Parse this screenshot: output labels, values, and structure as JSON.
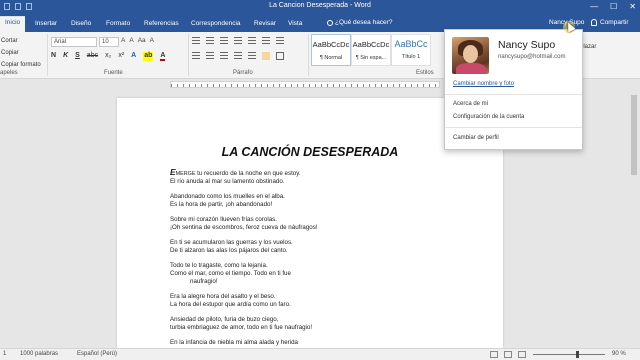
{
  "window": {
    "title": "La Cancion Desesperada - Word",
    "controls": [
      "—",
      "☐",
      "✕"
    ]
  },
  "tabs": [
    "Inicio",
    "Insertar",
    "Diseño",
    "Formato",
    "Referencias",
    "Correspondencia",
    "Revisar",
    "Vista"
  ],
  "tell_me": "¿Qué desea hacer?",
  "account": {
    "name_short": "Nancy Supo",
    "share_label": "Compartir"
  },
  "clipboard": {
    "items": [
      "Cortar",
      "Copiar",
      "Copiar formato"
    ],
    "group": "apeles"
  },
  "font": {
    "family": "Arial",
    "size": "10",
    "group": "Fuente",
    "size_buttons": [
      "A",
      "A",
      "Aa",
      "A"
    ]
  },
  "paragraph": {
    "group": "Párrafo"
  },
  "styles": {
    "group": "Estilos",
    "items": [
      {
        "preview": "AaBbCcDc",
        "name": "¶ Normal"
      },
      {
        "preview": "AaBbCcDc",
        "name": "¶ Sin espa..."
      },
      {
        "preview": "AaBbCc",
        "name": "Título 1"
      }
    ]
  },
  "ribbon_right": "plazar",
  "popup": {
    "name": "Nancy Supo",
    "email": "nancysupo@hotmail.com",
    "change_photo": "Cambiar nombre y foto",
    "about": "Acerca de mí",
    "settings": "Configuración de la cuenta",
    "switch_profile": "Cambiar de perfil"
  },
  "document": {
    "title": "LA CANCIÓN DESESPERADA",
    "drop_cap": "E",
    "first_word_rest": "MERGE",
    "first_line_rest": " tu recuerdo de la noche en que estoy.",
    "stanzas": [
      [
        "El río anuda al mar su lamento obstinado."
      ],
      [
        "Abandonado como los muelles en el alba.",
        "Es la hora de partir, ¡oh abandonado!"
      ],
      [
        "Sobre mi corazón llueven frías corolas.",
        "¡Oh sentina de escombros, feroz cueva de náufragos!"
      ],
      [
        "En ti se acumularon las guerras y los vuelos.",
        "De ti alzaron las alas los pájaros del canto."
      ],
      [
        "Todo te lo tragaste, como la lejanía.",
        "Como el mar, como el tiempo. Todo en ti fue",
        "naufragio!"
      ],
      [
        "Era la alegre hora del asalto y el beso.",
        "La hora del estupor que ardía como un faro."
      ],
      [
        "Ansiedad de piloto, furia de buzo ciego,",
        "turbia embriaguez de amor, todo en ti fue naufragio!"
      ],
      [
        "En la infancia de niebla mi alma alada y herida"
      ]
    ]
  },
  "status": {
    "page": "1",
    "words": "1000 palabras",
    "language": "Español (Perú)",
    "zoom": "90 %"
  }
}
